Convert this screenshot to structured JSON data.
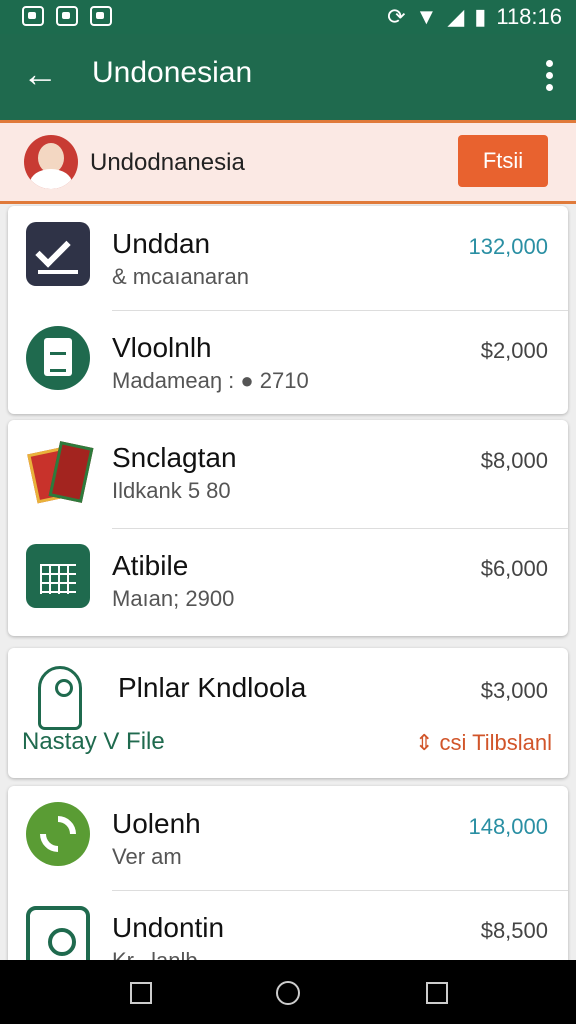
{
  "status_bar": {
    "time": "118:16"
  },
  "app_bar": {
    "title": "Undonesian"
  },
  "banner": {
    "text": "Undodnanesia",
    "button_label": "Ftsii"
  },
  "card1": {
    "rows": [
      {
        "title": "Unddan",
        "subtitle": "& mcaıanaran",
        "price": "132,000"
      },
      {
        "title": "Vloolnlh",
        "subtitle": "Madameaŋ : ● 2710",
        "price": "$2,000"
      }
    ]
  },
  "card2": {
    "rows": [
      {
        "title": "Snclagtan",
        "subtitle": "Ildkank 5 80",
        "price": "$8,000"
      },
      {
        "title": "Atibile",
        "subtitle": "Maıan; 2900",
        "price": "$6,000"
      }
    ]
  },
  "card3": {
    "title": "Plnlar Kndloola",
    "price": "$3,000",
    "link": "Nastay V File",
    "action": "⇕ csi Tilbslanl"
  },
  "card4": {
    "rows": [
      {
        "title": "Uolenh",
        "subtitle": "Ver am",
        "price": "148,000"
      },
      {
        "title": "Undontin",
        "subtitle": "Kr...lanlb....",
        "price": "$8,500"
      }
    ]
  },
  "colors": {
    "primary": "#1f6a4e",
    "accent": "#e8622f",
    "teal_price": "#2a8fa3"
  }
}
